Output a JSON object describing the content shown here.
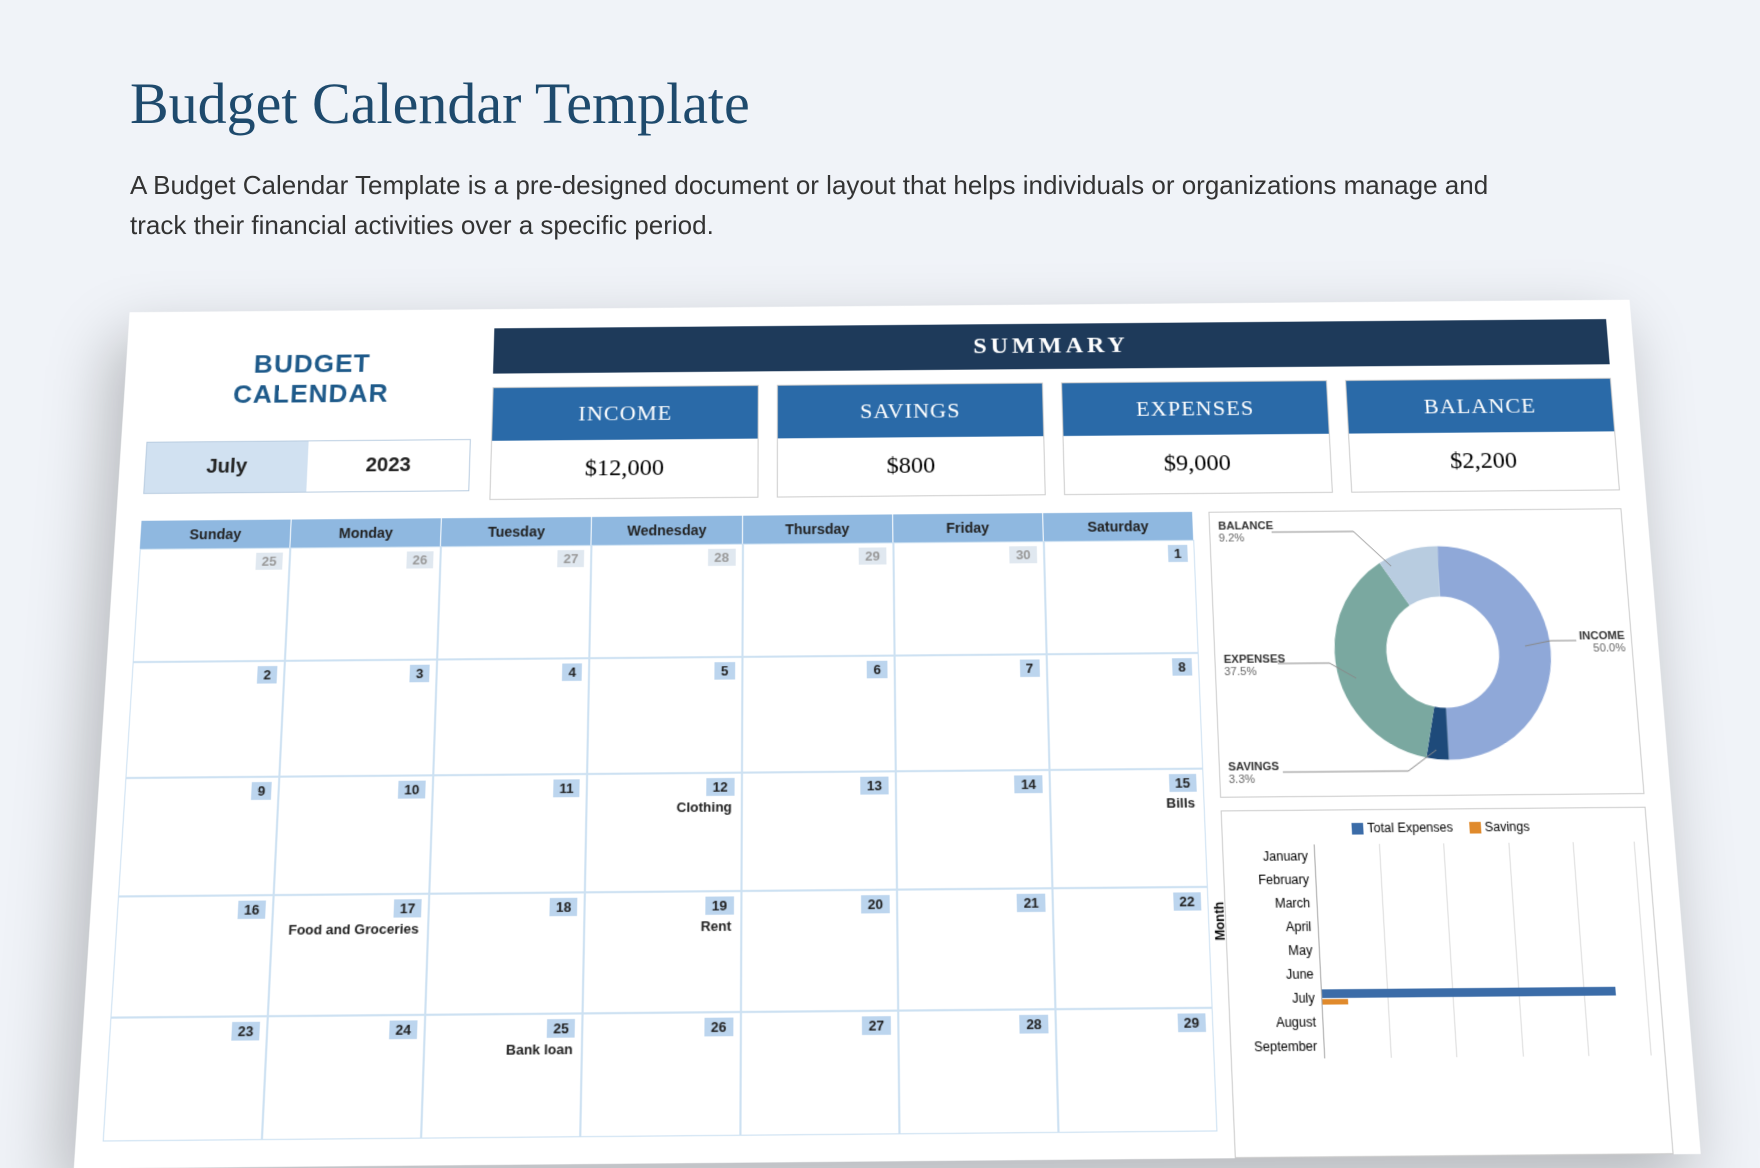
{
  "title": "Budget Calendar Template",
  "subtitle": "A Budget Calendar Template is a pre-designed document or layout that helps individuals or organizations manage and track their financial activities over a specific period.",
  "header": {
    "budget_calendar": "BUDGET CALENDAR",
    "month": "July",
    "year": "2023",
    "summary": "SUMMARY"
  },
  "cards": {
    "income_h": "INCOME",
    "income_v": "$12,000",
    "savings_h": "SAVINGS",
    "savings_v": "$800",
    "expenses_h": "EXPENSES",
    "expenses_v": "$9,000",
    "balance_h": "BALANCE",
    "balance_v": "$2,200"
  },
  "dow": [
    "Sunday",
    "Monday",
    "Tuesday",
    "Wednesday",
    "Thursday",
    "Friday",
    "Saturday"
  ],
  "weeks": [
    [
      {
        "n": "25",
        "dim": true
      },
      {
        "n": "26",
        "dim": true
      },
      {
        "n": "27",
        "dim": true
      },
      {
        "n": "28",
        "dim": true
      },
      {
        "n": "29",
        "dim": true
      },
      {
        "n": "30",
        "dim": true
      },
      {
        "n": "1"
      }
    ],
    [
      {
        "n": "2"
      },
      {
        "n": "3"
      },
      {
        "n": "4"
      },
      {
        "n": "5"
      },
      {
        "n": "6"
      },
      {
        "n": "7"
      },
      {
        "n": "8"
      }
    ],
    [
      {
        "n": "9"
      },
      {
        "n": "10"
      },
      {
        "n": "11"
      },
      {
        "n": "12",
        "evt": "Clothing"
      },
      {
        "n": "13"
      },
      {
        "n": "14"
      },
      {
        "n": "15",
        "evt": "Bills"
      }
    ],
    [
      {
        "n": "16"
      },
      {
        "n": "17",
        "evt": "Food and Groceries"
      },
      {
        "n": "18"
      },
      {
        "n": "19",
        "evt": "Rent"
      },
      {
        "n": "20"
      },
      {
        "n": "21"
      },
      {
        "n": "22"
      }
    ],
    [
      {
        "n": "23"
      },
      {
        "n": "24"
      },
      {
        "n": "25",
        "evt": "Bank loan"
      },
      {
        "n": "26"
      },
      {
        "n": "27"
      },
      {
        "n": "28"
      },
      {
        "n": "29"
      }
    ]
  ],
  "chart_data": [
    {
      "type": "pie",
      "title": "",
      "series": [
        {
          "name": "INCOME",
          "value": 50.0,
          "label": "50.0%",
          "color": "#8fa8d8"
        },
        {
          "name": "SAVINGS",
          "value": 3.3,
          "label": "3.3%",
          "color": "#1e4a7a"
        },
        {
          "name": "EXPENSES",
          "value": 37.5,
          "label": "37.5%",
          "color": "#7aa8a0"
        },
        {
          "name": "BALANCE",
          "value": 9.2,
          "label": "9.2%",
          "color": "#b8cce0"
        }
      ]
    },
    {
      "type": "bar",
      "orientation": "horizontal",
      "ylabel": "Month",
      "legend": [
        "Total Expenses",
        "Savings"
      ],
      "legend_colors": [
        "#3b6ca8",
        "#e08a2c"
      ],
      "categories": [
        "January",
        "February",
        "March",
        "April",
        "May",
        "June",
        "July",
        "August",
        "September"
      ],
      "series": [
        {
          "name": "Total Expenses",
          "values": [
            0,
            0,
            0,
            0,
            0,
            0,
            9000,
            0,
            0
          ]
        },
        {
          "name": "Savings",
          "values": [
            0,
            0,
            0,
            0,
            0,
            0,
            800,
            0,
            0
          ]
        }
      ],
      "xlim": [
        0,
        10000
      ]
    }
  ],
  "donut_labels": {
    "balance": "BALANCE",
    "balance_pct": "9.2%",
    "income": "INCOME",
    "income_pct": "50.0%",
    "expenses": "EXPENSES",
    "expenses_pct": "37.5%",
    "savings": "SAVINGS",
    "savings_pct": "3.3%"
  },
  "bar_legend": {
    "exp": "Total Expenses",
    "sav": "Savings"
  },
  "bar_ylabel": "Month",
  "months_list": [
    "January",
    "February",
    "March",
    "April",
    "May",
    "June",
    "July",
    "August",
    "September"
  ]
}
